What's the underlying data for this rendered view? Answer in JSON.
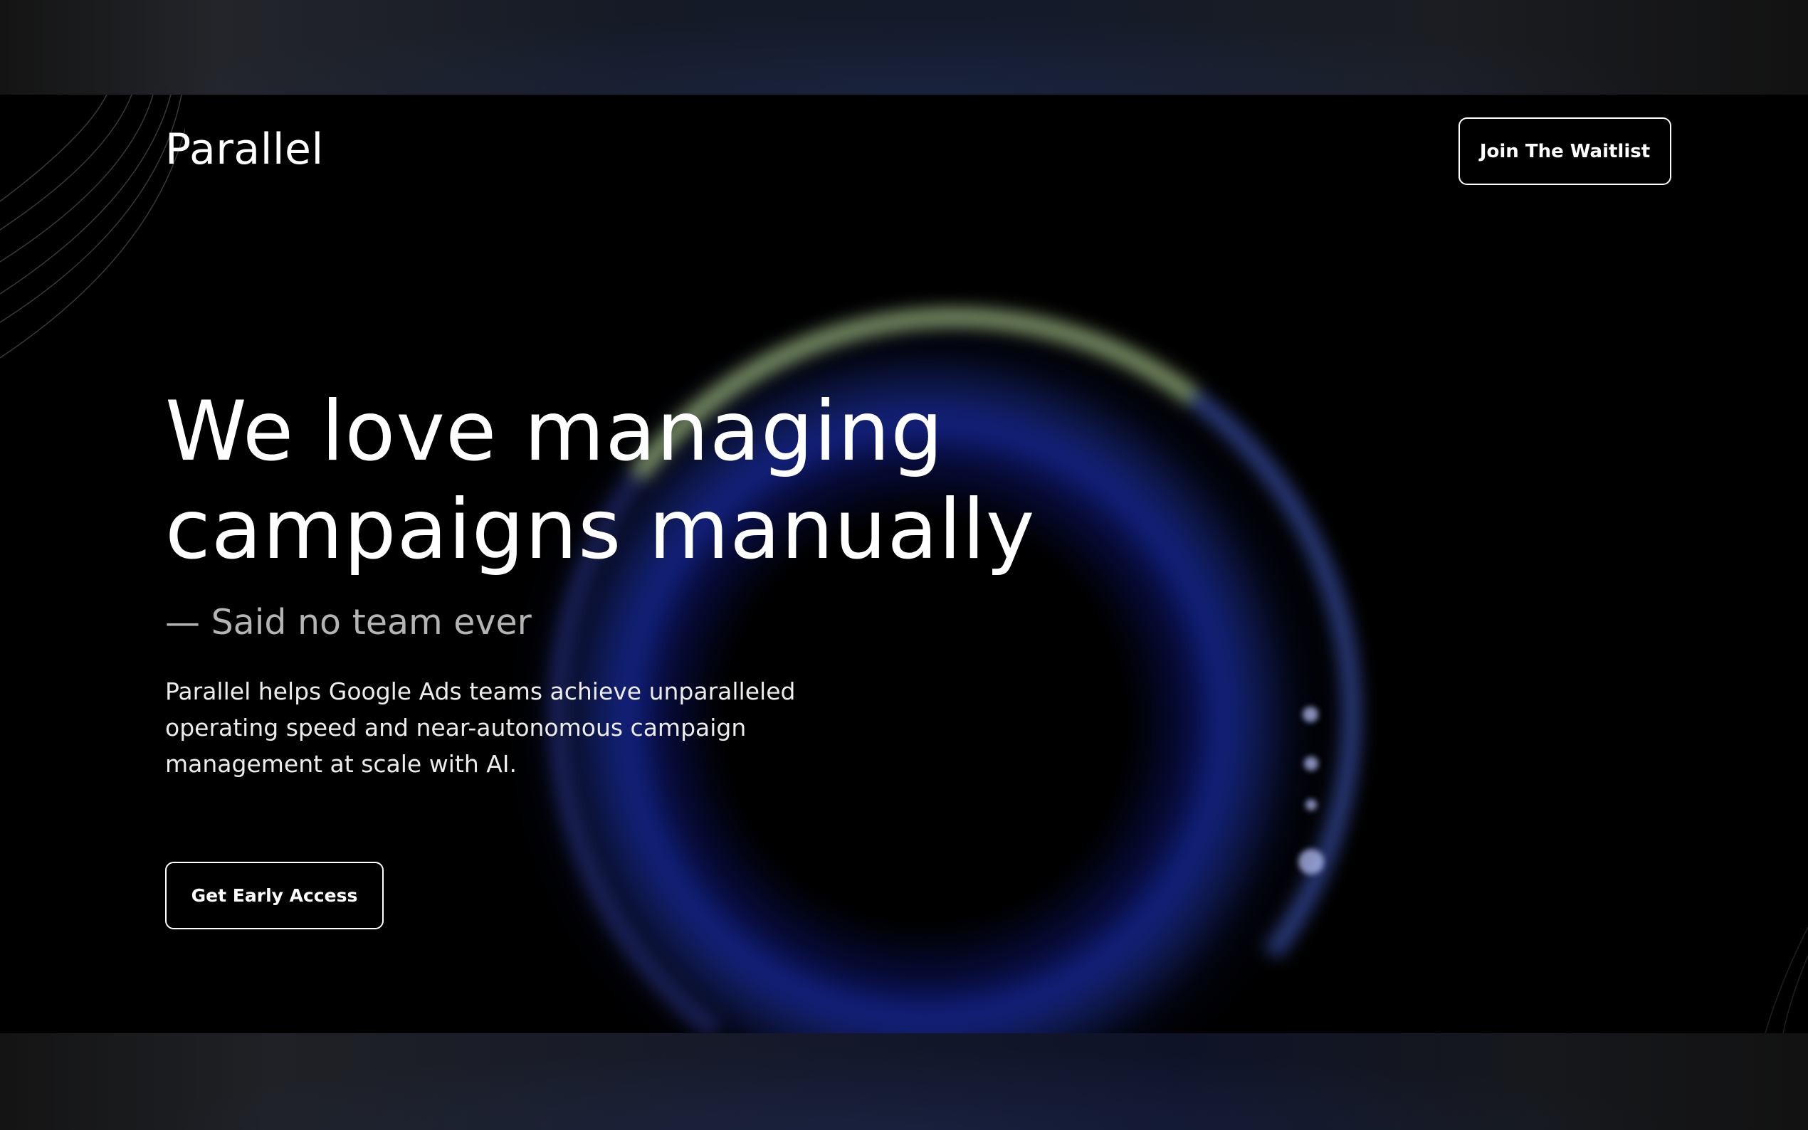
{
  "header": {
    "logo": "Parallel",
    "waitlist_button": "Join The Waitlist"
  },
  "hero": {
    "headline_line1": "We love managing",
    "headline_line2": "campaigns manually",
    "quote": "— Said no team ever",
    "description": "Parallel helps Google Ads teams achieve unparalleled operating speed and near-autonomous campaign management at scale with AI.",
    "cta_button": "Get Early Access"
  },
  "colors": {
    "background": "#000000",
    "text": "#ffffff",
    "muted_text": "#b4b4b4",
    "ring_blue": "#2a46d8",
    "ring_highlight": "#aac88c"
  }
}
